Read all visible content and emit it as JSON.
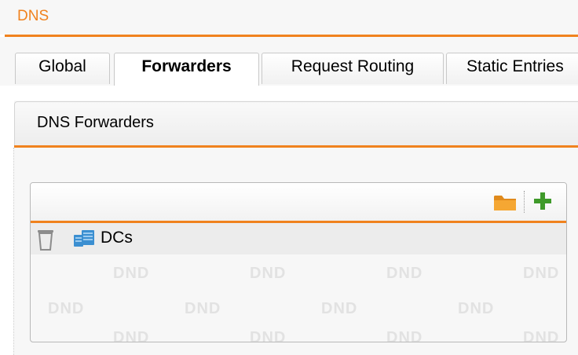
{
  "header": {
    "title": "DNS"
  },
  "tabs": [
    {
      "label": "Global",
      "active": false
    },
    {
      "label": "Forwarders",
      "active": true
    },
    {
      "label": "Request Routing",
      "active": false
    },
    {
      "label": "Static Entries",
      "active": false
    }
  ],
  "section": {
    "title": "DNS Forwarders"
  },
  "toolbar": {
    "folder_icon": "folder-icon",
    "add_icon": "plus-icon"
  },
  "list": {
    "items": [
      {
        "label": "DCs",
        "delete_icon": "trash-icon",
        "type_icon": "server-icon"
      }
    ],
    "watermark": "DND"
  },
  "colors": {
    "accent": "#f0821e",
    "add": "#3f9a2a",
    "server": "#3b8fd1",
    "folder": "#f0a030"
  }
}
